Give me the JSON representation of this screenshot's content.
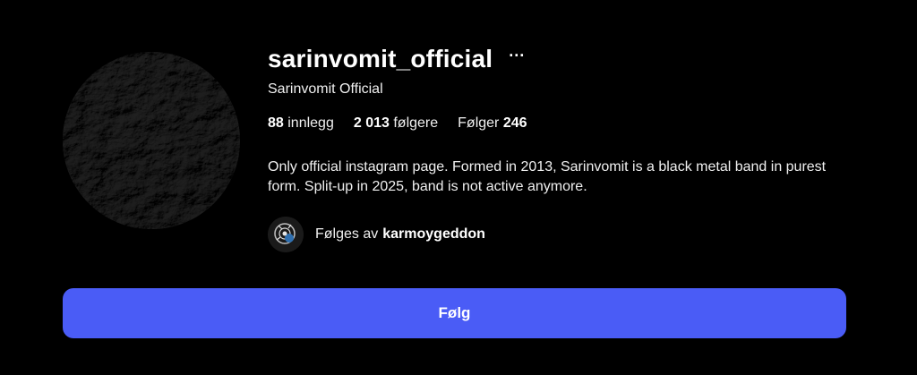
{
  "profile": {
    "username": "sarinvomit_official",
    "more_label": "···",
    "full_name": "Sarinvomit Official",
    "avatar_icon": "dark-rock-texture-avatar",
    "stats": {
      "posts_count": "88",
      "posts_label": "innlegg",
      "followers_count": "2 013",
      "followers_label": "følgere",
      "following_label": "Følger",
      "following_count": "246"
    },
    "bio": "Only official instagram page. Formed in 2013, Sarinvomit is a black metal band in purest form. Split-up in 2025, band is not active anymore.",
    "followed_by": {
      "prefix": "Følges av",
      "account": "karmoygeddon",
      "avatar_icon": "karmoygeddon-avatar"
    },
    "follow_button_label": "Følg"
  },
  "colors": {
    "background": "#000000",
    "text": "#f5f5f5",
    "follow_button": "#4a5cf6"
  }
}
